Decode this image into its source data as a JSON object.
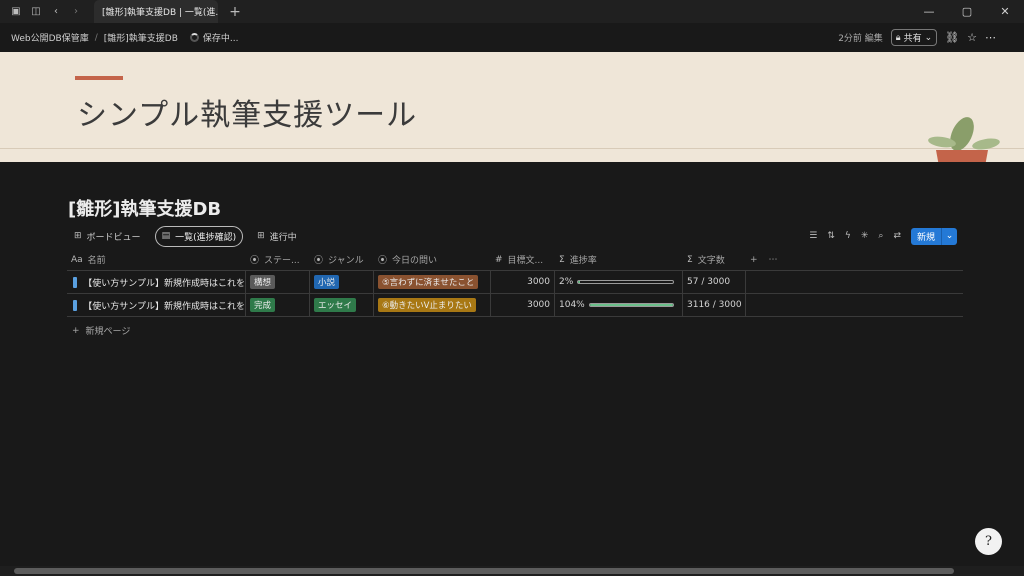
{
  "browser": {
    "tab_title": "[雛形]執筆支援DB | 一覧(進...",
    "tab_close": "✕",
    "new_tab": "+",
    "window_controls": [
      "—",
      "▢",
      "✕"
    ]
  },
  "topbar": {
    "breadcrumbs": [
      "Web公開DB保管庫",
      "[雛形]執筆支援DB"
    ],
    "separator": "/",
    "saving": "保存中...",
    "edited": "2分前 編集",
    "share": "共有"
  },
  "cover": {
    "title": "シンプル執筆支援ツール"
  },
  "database": {
    "title": "[雛形]執筆支援DB",
    "views": [
      {
        "label": "ボードビュー",
        "icon": "⊞"
      },
      {
        "label": "一覧(進捗確認)",
        "icon": "▤"
      },
      {
        "label": "進行中",
        "icon": "⊞"
      }
    ],
    "new_button": "新規",
    "columns": [
      {
        "label": "名前",
        "icon": "Aa"
      },
      {
        "label": "ステー...",
        "icon": "⦿"
      },
      {
        "label": "ジャンル",
        "icon": "⦿"
      },
      {
        "label": "今日の問い",
        "icon": "⦿"
      },
      {
        "label": "目標文...",
        "icon": "#"
      },
      {
        "label": "進捗率",
        "icon": "Σ"
      },
      {
        "label": "文字数",
        "icon": "Σ"
      }
    ],
    "rows": [
      {
        "name": "【使い方サンプル】新規作成時はこれを",
        "status": {
          "text": "構想",
          "color": "#5a5a5a"
        },
        "genre": {
          "text": "小説",
          "color": "#2167b1"
        },
        "question": {
          "text": "⑤言わずに済ませたこと",
          "color": "#8a5230"
        },
        "goal": "3000",
        "progress_label": "2%",
        "progress": 0.02,
        "count": "57 / 3000"
      },
      {
        "name": "【使い方サンプル】新規作成時はこれを",
        "status": {
          "text": "完成",
          "color": "#2f7a4a"
        },
        "genre": {
          "text": "エッセイ",
          "color": "#2f7a4a"
        },
        "question": {
          "text": "⑥動きたいV止まりたい",
          "color": "#a87814"
        },
        "goal": "3000",
        "progress_label": "104%",
        "progress": 1.0,
        "count": "3116 / 3000"
      }
    ],
    "new_page": "新規ページ"
  },
  "help": "?"
}
